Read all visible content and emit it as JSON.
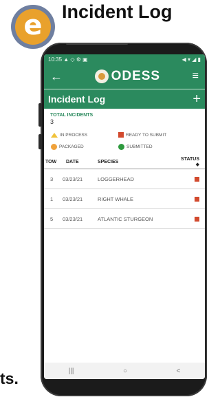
{
  "header": {
    "badge_letter": "e",
    "title": "Incident Log"
  },
  "page_fragment_text": "ts.",
  "device": {
    "status_bar": {
      "time": "10:35",
      "left_icons": "▲ ◇ ⚙ ▣",
      "right_icons": "◀ ▾ ◢ ▮"
    },
    "app_bar": {
      "back_icon": "back-arrow-icon",
      "logo_text": "ODESS",
      "menu_icon": "hamburger-menu-icon"
    },
    "sub_bar": {
      "title": "Incident Log",
      "add_icon": "plus-icon"
    },
    "totals": {
      "label": "TOTAL INCIDENTS",
      "value": "3"
    },
    "legend": [
      {
        "label": "IN PROCESS",
        "shape": "triangle",
        "color": "#f0c23a"
      },
      {
        "label": "READY TO SUBMIT",
        "shape": "square",
        "color": "#d24a2e"
      },
      {
        "label": "PACKAGED",
        "shape": "circle",
        "color": "#f0a23a"
      },
      {
        "label": "SUBMITTED",
        "shape": "circle",
        "color": "#2e9a3e"
      }
    ],
    "table": {
      "headers": {
        "tow": "TOW",
        "date": "DATE",
        "species": "SPECIES",
        "status": "STATUS ◆"
      },
      "rows": [
        {
          "tow": "3",
          "date": "03/23/21",
          "species": "LOGGERHEAD",
          "status": "ready-to-submit"
        },
        {
          "tow": "1",
          "date": "03/23/21",
          "species": "RIGHT WHALE",
          "status": "ready-to-submit"
        },
        {
          "tow": "5",
          "date": "03/23/21",
          "species": "ATLANTIC STURGEON",
          "status": "ready-to-submit"
        }
      ]
    },
    "nav": {
      "recents": "|||",
      "home": "○",
      "back": "<"
    }
  }
}
